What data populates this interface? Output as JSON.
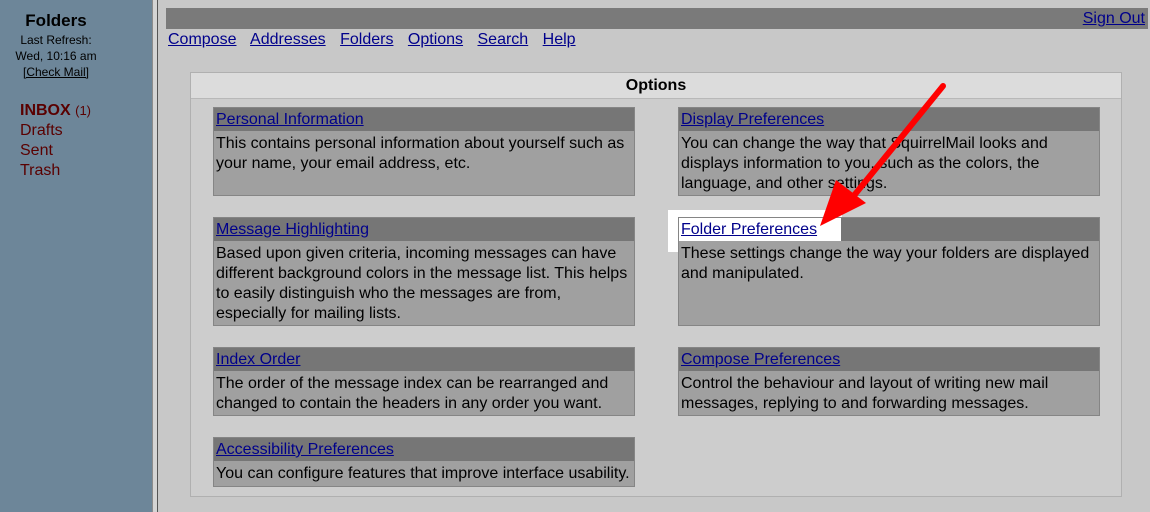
{
  "sidebar": {
    "title": "Folders",
    "last_refresh_label": "Last Refresh:",
    "refresh_time": "Wed, 10:16 am",
    "check_mail_label": "[Check Mail]",
    "folders": [
      {
        "label": "INBOX",
        "unread": "(1)"
      },
      {
        "label": "Drafts"
      },
      {
        "label": "Sent"
      },
      {
        "label": "Trash"
      }
    ]
  },
  "header": {
    "sign_out": "Sign Out",
    "nav": [
      "Compose",
      "Addresses",
      "Folders",
      "Options",
      "Search",
      "Help"
    ]
  },
  "options": {
    "title": "Options",
    "cards": [
      {
        "title": "Personal Information",
        "description": "This contains personal information about yourself such as your name, your email address, etc."
      },
      {
        "title": "Display Preferences",
        "description": "You can change the way that SquirrelMail looks and displays information to you, such as the colors, the language, and other settings."
      },
      {
        "title": "Message Highlighting",
        "description": "Based upon given criteria, incoming messages can have different background colors in the message list. This helps to easily distinguish who the messages are from, especially for mailing lists."
      },
      {
        "title": "Folder Preferences",
        "description": "These settings change the way your folders are displayed and manipulated."
      },
      {
        "title": "Index Order",
        "description": "The order of the message index can be rearranged and changed to contain the headers in any order you want."
      },
      {
        "title": "Compose Preferences",
        "description": "Control the behaviour and layout of writing new mail messages, replying to and forwarding messages."
      },
      {
        "title": "Accessibility Preferences",
        "description": "You can configure features that improve interface usability."
      }
    ]
  },
  "colors": {
    "sidebar_bg": "#6d8699",
    "link": "#00008b",
    "folder_text": "#5a0000",
    "annotation_arrow": "#ff0000"
  },
  "annotation": {
    "type": "arrow",
    "points_to": "Folder Preferences"
  }
}
